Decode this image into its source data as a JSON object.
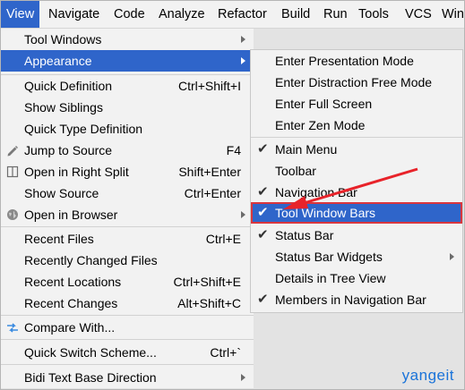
{
  "menubar": {
    "items": [
      {
        "label": "View"
      },
      {
        "label": "Navigate"
      },
      {
        "label": "Code"
      },
      {
        "label": "Analyze"
      },
      {
        "label": "Refactor"
      },
      {
        "label": "Build"
      },
      {
        "label": "Run"
      },
      {
        "label": "Tools"
      },
      {
        "label": "VCS"
      },
      {
        "label": "Win"
      }
    ]
  },
  "view_menu": {
    "items": [
      {
        "label": "Tool Windows",
        "shortcut": ""
      },
      {
        "label": "Appearance",
        "shortcut": ""
      },
      {
        "label": "Quick Definition",
        "shortcut": "Ctrl+Shift+I"
      },
      {
        "label": "Show Siblings",
        "shortcut": ""
      },
      {
        "label": "Quick Type Definition",
        "shortcut": ""
      },
      {
        "label": "Jump to Source",
        "shortcut": "F4"
      },
      {
        "label": "Open in Right Split",
        "shortcut": "Shift+Enter"
      },
      {
        "label": "Show Source",
        "shortcut": "Ctrl+Enter"
      },
      {
        "label": "Open in Browser",
        "shortcut": ""
      },
      {
        "label": "Recent Files",
        "shortcut": "Ctrl+E"
      },
      {
        "label": "Recently Changed Files",
        "shortcut": ""
      },
      {
        "label": "Recent Locations",
        "shortcut": "Ctrl+Shift+E"
      },
      {
        "label": "Recent Changes",
        "shortcut": "Alt+Shift+C"
      },
      {
        "label": "Compare With...",
        "shortcut": ""
      },
      {
        "label": "Quick Switch Scheme...",
        "shortcut": "Ctrl+`"
      },
      {
        "label": "Bidi Text Base Direction",
        "shortcut": ""
      }
    ]
  },
  "appearance_menu": {
    "items": [
      {
        "label": "Enter Presentation Mode"
      },
      {
        "label": "Enter Distraction Free Mode"
      },
      {
        "label": "Enter Full Screen"
      },
      {
        "label": "Enter Zen Mode"
      },
      {
        "label": "Main Menu",
        "check": "✔"
      },
      {
        "label": "Toolbar",
        "check": ""
      },
      {
        "label": "Navigation Bar",
        "check": "✔"
      },
      {
        "label": "Tool Window Bars",
        "check": "✔"
      },
      {
        "label": "Status Bar",
        "check": "✔"
      },
      {
        "label": "Status Bar Widgets",
        "check": ""
      },
      {
        "label": "Details in Tree View",
        "check": ""
      },
      {
        "label": "Members in Navigation Bar",
        "check": "✔"
      }
    ]
  },
  "watermark": "yangeit",
  "colors": {
    "selection": "#2f65ca",
    "highlight_border": "#d9363e",
    "annotation_arrow": "#e8232a"
  }
}
